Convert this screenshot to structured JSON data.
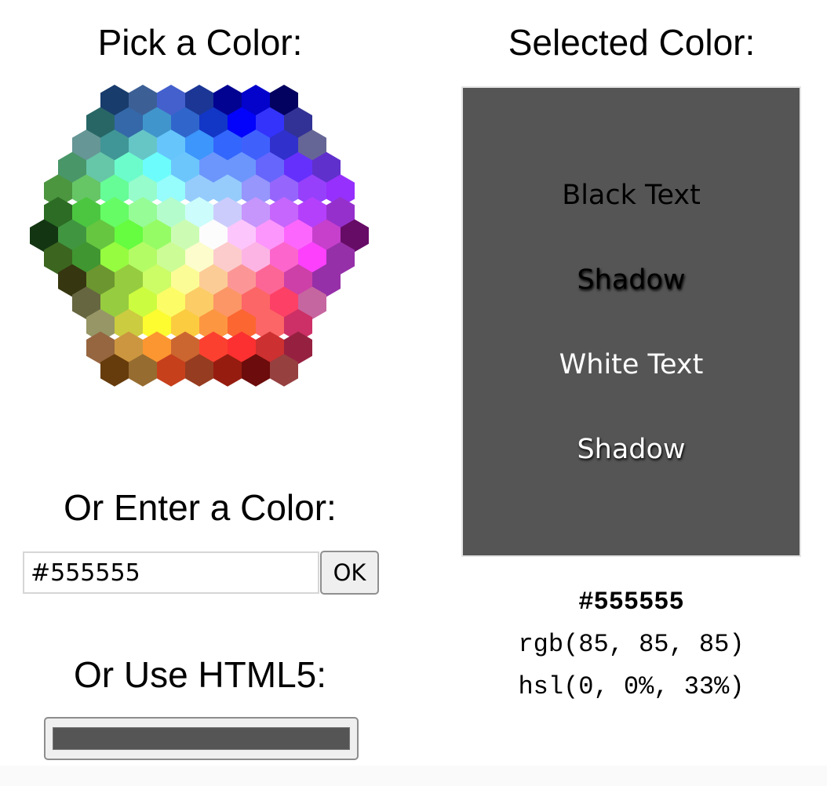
{
  "picker": {
    "heading": "Pick a Color:",
    "hex_rows": [
      [
        "#183C6C",
        "#3C6096",
        "#4460CC",
        "#1B3695",
        "#030392",
        "#0303CC",
        "#030260"
      ],
      [
        "#286666",
        "#3468A8",
        "#4096CC",
        "#3066CC",
        "#1236C6",
        "#0303FC",
        "#3333FC",
        "#323296"
      ],
      [
        "#669696",
        "#409696",
        "#66C6C6",
        "#66C6FC",
        "#3C96FC",
        "#3366FC",
        "#4060FC",
        "#3030CC",
        "#666696"
      ],
      [
        "#499669",
        "#66C6A8",
        "#6CFCCC",
        "#6CFCFC",
        "#6CC6FC",
        "#6C96FC",
        "#6C96FC",
        "#6666FC",
        "#6630FC",
        "#6030CC"
      ],
      [
        "#4C9640",
        "#66C666",
        "#66FC96",
        "#96FCCC",
        "#96FCFC",
        "#96CCFC",
        "#96CCFC",
        "#9696FC",
        "#9666FC",
        "#9640FC",
        "#9630FC"
      ],
      [
        "#2C6C24",
        "#4CC640",
        "#66FC66",
        "#96FC96",
        "#B4FCCC",
        "#CCFCFC",
        "#CCCCFC",
        "#C696FC",
        "#C666FC",
        "#B440FC",
        "#9630CC"
      ],
      [
        "#133512",
        "#409640",
        "#66C640",
        "#66FC40",
        "#96FC66",
        "#CCFCB4",
        "#FCFCFC",
        "#FCC6FC",
        "#FC96FC",
        "#FC66FC",
        "#C640CC",
        "#660C66"
      ],
      [
        "#3C6620",
        "#409630",
        "#96FC40",
        "#B4FC66",
        "#CCFC96",
        "#FCFCCC",
        "#FCCCCC",
        "#FCB4E4",
        "#FC66CC",
        "#FC40FC",
        "#9630A8"
      ],
      [
        "#363610",
        "#6C9630",
        "#96CC40",
        "#CCFC66",
        "#FCFC96",
        "#FCCC96",
        "#FC9696",
        "#FC6696",
        "#CC40A8",
        "#9630A8"
      ],
      [
        "#666640",
        "#96CC40",
        "#CCFC40",
        "#FCFC66",
        "#FCCC66",
        "#FC9666",
        "#FC6666",
        "#FC4066",
        "#C666A0"
      ],
      [
        "#969666",
        "#CCCC40",
        "#FCFC30",
        "#FCCC40",
        "#FC9640",
        "#FC6630",
        "#FC6666",
        "#CC3066"
      ],
      [
        "#966640",
        "#CC9640",
        "#FC9630",
        "#CC6630",
        "#FC4030",
        "#FC3030",
        "#CC3030",
        "#962040"
      ],
      [
        "#663C0C",
        "#966C30",
        "#C6401C",
        "#963C20",
        "#961C10",
        "#6C0C0C",
        "#964040"
      ]
    ]
  },
  "enter": {
    "heading": "Or Enter a Color:",
    "input_value": "#555555",
    "ok_label": "OK"
  },
  "html5": {
    "heading": "Or Use HTML5:",
    "value": "#555555"
  },
  "selected": {
    "heading": "Selected Color:",
    "color": "#555555",
    "black_text": "Black Text",
    "black_shadow": "Shadow",
    "white_text": "White Text",
    "white_shadow": "Shadow",
    "hex": "#555555",
    "rgb": "rgb(85, 85, 85)",
    "hsl": "hsl(0, 0%, 33%)"
  }
}
